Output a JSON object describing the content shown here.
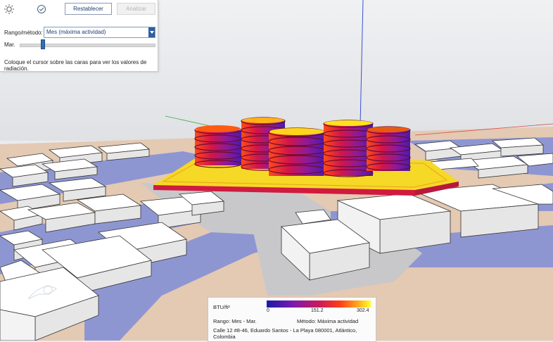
{
  "toolbar": {
    "sun_icon": "sun-icon",
    "check_icon": "check-icon",
    "reset_label": "Restablecer",
    "analyze_label": "Analizar"
  },
  "panel": {
    "range_label": "Rango/método:",
    "range_value": "Mes (máxima actividad)",
    "month_label": "Mar.",
    "month_slider_fraction": 0.17,
    "hint": "Coloque el cursor sobre las caras para ver los valores de radiación."
  },
  "legend": {
    "unit": "BTU/ft²",
    "min": "0",
    "mid": "151.2",
    "max": "302.4",
    "range": "Rango: Mes - Mar.",
    "method": "Método: Máxima actividad",
    "address": "Calle 12 #8-46, Eduardo Santos - La Playa 080001, Atlántico, Colombia",
    "colors": [
      "#1a1aa6",
      "#7a1ab0",
      "#c81a5a",
      "#ff3a1a",
      "#ffa51a",
      "#ffff2a"
    ]
  },
  "scene": {
    "ground_color": "#e2c7b2",
    "road_color": "#8d95d0",
    "building_color": "#ffffff",
    "site_color": "#f4d825"
  }
}
